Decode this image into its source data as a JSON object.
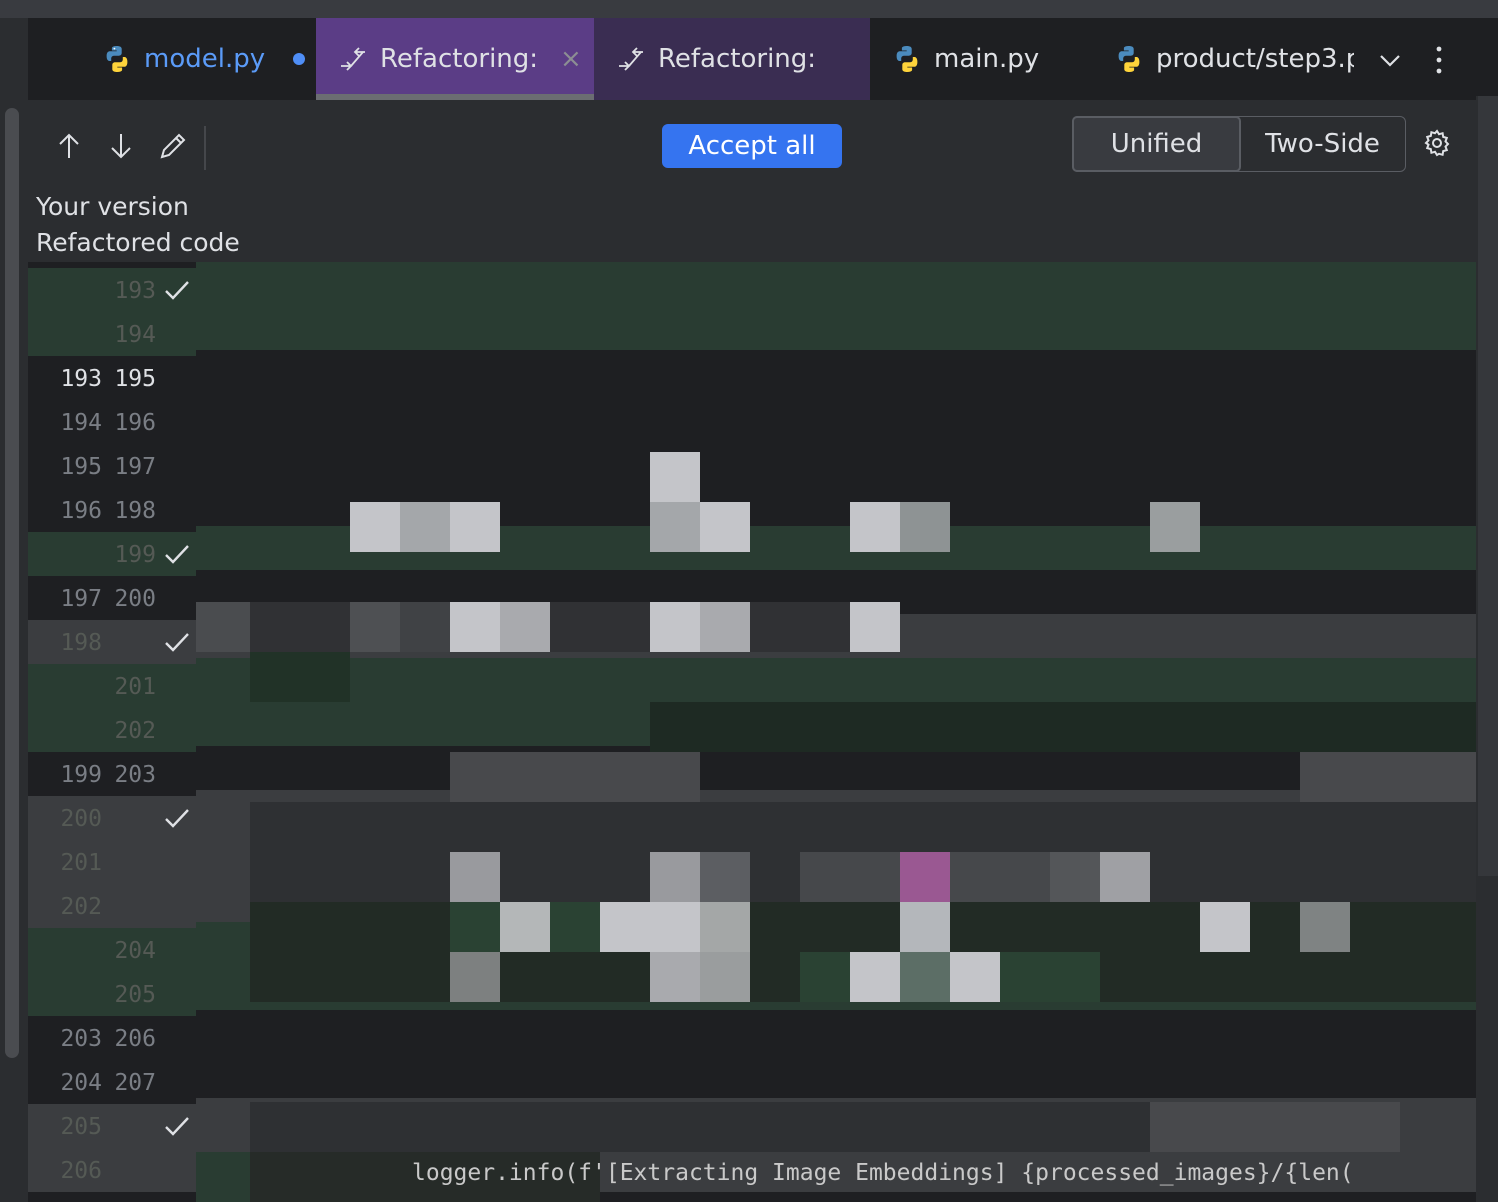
{
  "tabs": [
    {
      "label": "model.py",
      "modified": true,
      "icon": "python-icon"
    },
    {
      "label": "Refactoring:",
      "active": true,
      "icon": "refactoring-icon"
    },
    {
      "label": "Refactoring:",
      "icon": "refactoring-icon"
    },
    {
      "label": "main.py",
      "icon": "python-icon"
    },
    {
      "label": "product/step3.p",
      "icon": "python-icon"
    }
  ],
  "toolbar": {
    "accept_all": "Accept all",
    "mode_unified": "Unified",
    "mode_two_side": "Two-Side",
    "icons": [
      "arrow-up-icon",
      "arrow-down-icon",
      "pencil-icon",
      "gear-icon"
    ]
  },
  "labels": {
    "your_version": "Your version",
    "refactored_code": "Refactored code"
  },
  "gutter": [
    {
      "old": "",
      "new": "193",
      "check": true,
      "kind": "added"
    },
    {
      "old": "",
      "new": "194",
      "check": false,
      "kind": "added"
    },
    {
      "old": "193",
      "new": "195",
      "check": false,
      "kind": "context"
    },
    {
      "old": "194",
      "new": "196",
      "check": false,
      "kind": "context"
    },
    {
      "old": "195",
      "new": "197",
      "check": false,
      "kind": "context"
    },
    {
      "old": "196",
      "new": "198",
      "check": false,
      "kind": "context"
    },
    {
      "old": "",
      "new": "199",
      "check": true,
      "kind": "added"
    },
    {
      "old": "197",
      "new": "200",
      "check": false,
      "kind": "context"
    },
    {
      "old": "198",
      "new": "",
      "check": true,
      "kind": "removed"
    },
    {
      "old": "",
      "new": "201",
      "check": false,
      "kind": "added"
    },
    {
      "old": "",
      "new": "202",
      "check": false,
      "kind": "added"
    },
    {
      "old": "199",
      "new": "203",
      "check": false,
      "kind": "context"
    },
    {
      "old": "200",
      "new": "",
      "check": true,
      "kind": "removed"
    },
    {
      "old": "201",
      "new": "",
      "check": false,
      "kind": "removed"
    },
    {
      "old": "202",
      "new": "",
      "check": false,
      "kind": "removed"
    },
    {
      "old": "",
      "new": "204",
      "check": false,
      "kind": "added"
    },
    {
      "old": "",
      "new": "205",
      "check": false,
      "kind": "added"
    },
    {
      "old": "203",
      "new": "206",
      "check": false,
      "kind": "context"
    },
    {
      "old": "204",
      "new": "207",
      "check": false,
      "kind": "context"
    },
    {
      "old": "205",
      "new": "",
      "check": true,
      "kind": "removed"
    },
    {
      "old": "206",
      "new": "",
      "check": false,
      "kind": "removed"
    }
  ],
  "code_overflow_line": "logger.info(f'[Extracting Image Embeddings] {processed_images}/{len(",
  "colors": {
    "added_bg": "#293c32",
    "removed_bg": "#3b3d40",
    "context_bg": "#1e1f22",
    "active_tab": "#5b3d86",
    "accent": "#3574f0"
  }
}
